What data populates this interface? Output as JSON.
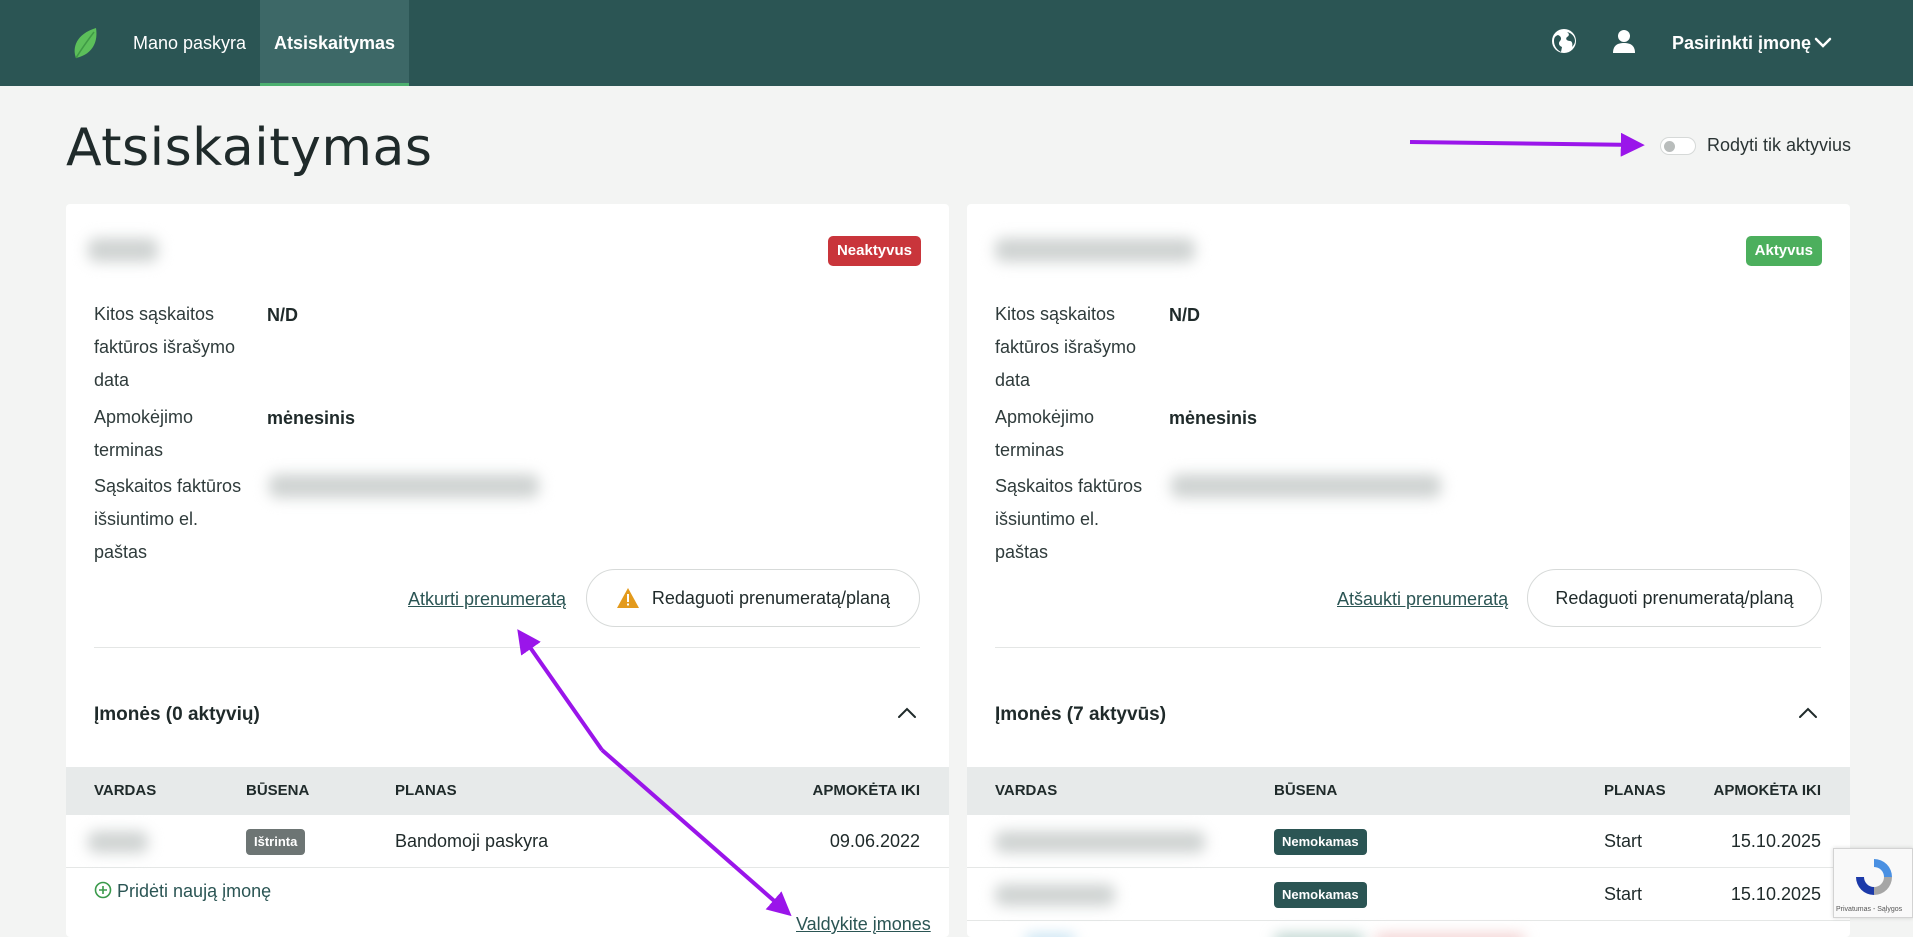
{
  "topbar": {
    "nav": [
      {
        "label": "Mano paskyra",
        "active": false
      },
      {
        "label": "Atsiskaitymas",
        "active": true
      }
    ],
    "company_select": "Pasirinkti įmonę",
    "icons": [
      "globe-icon",
      "user-icon",
      "chevron-down-icon"
    ],
    "colors": {
      "bar": "#2b5554",
      "active": "#3d6867",
      "accent": "#4caf6f"
    }
  },
  "page": {
    "title": "Atsiskaitymas",
    "toggle_label": "Rodyti tik aktyvius",
    "toggle_on": false
  },
  "cards": [
    {
      "status": "Neaktyvus",
      "status_color": "#c9353b",
      "fields": {
        "next_invoice_label": "Kitos sąskaitos faktūros išrašymo data",
        "next_invoice_value": "N/D",
        "billing_term_label": "Apmokėjimo terminas",
        "billing_term_value": "mėnesinis",
        "email_label": "Sąskaitos faktūros išsiuntimo el. paštas"
      },
      "actions": {
        "link": "Atkurti prenumeratą",
        "button": "Redaguoti prenumeratą/planą",
        "button_icon": "warning-icon"
      },
      "companies_title": "Įmonės (0 aktyvių)",
      "table": {
        "headers": [
          "VARDAS",
          "BŪSENA",
          "PLANAS",
          "APMOKĖTA IKI"
        ],
        "rows": [
          {
            "status": "Ištrinta",
            "plan": "Bandomoji paskyra",
            "paid_until": "09.06.2022"
          }
        ]
      },
      "add_company": "Pridėti naują įmonę",
      "manage_link": "Valdykite įmones"
    },
    {
      "status": "Aktyvus",
      "status_color": "#4caf5d",
      "fields": {
        "next_invoice_label": "Kitos sąskaitos faktūros išrašymo data",
        "next_invoice_value": "N/D",
        "billing_term_label": "Apmokėjimo terminas",
        "billing_term_value": "mėnesinis",
        "email_label": "Sąskaitos faktūros išsiuntimo el. paštas"
      },
      "actions": {
        "link": "Atšaukti prenumeratą",
        "button": "Redaguoti prenumeratą/planą"
      },
      "companies_title": "Įmonės (7 aktyvūs)",
      "table": {
        "headers": [
          "VARDAS",
          "BŪSENA",
          "PLANAS",
          "APMOKĖTA IKI"
        ],
        "rows": [
          {
            "status": "Nemokamas",
            "plan": "Start",
            "paid_until": "15.10.2025"
          },
          {
            "status": "Nemokamas",
            "plan": "Start",
            "paid_until": "15.10.2025"
          }
        ]
      }
    }
  ],
  "recaptcha": {
    "text": "Privatumas - Sąlygos"
  },
  "annotation_color": "#9a15ea"
}
